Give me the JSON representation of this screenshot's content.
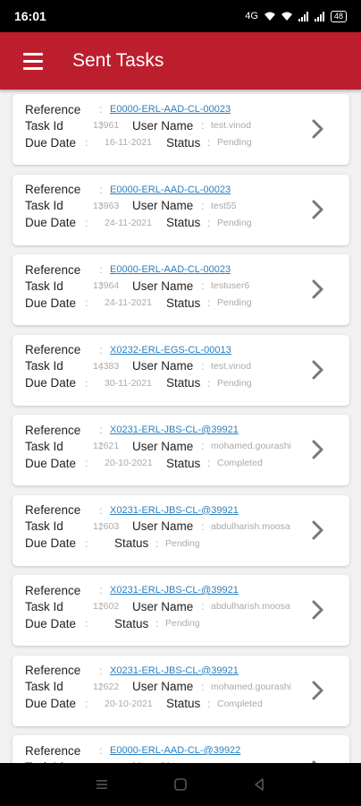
{
  "status_bar": {
    "time": "16:01",
    "battery": "48",
    "network": "4G"
  },
  "app_bar": {
    "title": "Sent Tasks"
  },
  "labels": {
    "reference": "Reference",
    "task_id": "Task Id",
    "user_name": "User Name",
    "due_date": "Due Date",
    "status": "Status",
    "colon": ":"
  },
  "tasks": [
    {
      "reference": "E0000-ERL-AAD-CL-00023",
      "task_id": "13961",
      "user_name": "test.vinod",
      "due_date": "16-11-2021",
      "status": "Pending"
    },
    {
      "reference": "E0000-ERL-AAD-CL-00023",
      "task_id": "13963",
      "user_name": "test55",
      "due_date": "24-11-2021",
      "status": "Pending"
    },
    {
      "reference": "E0000-ERL-AAD-CL-00023",
      "task_id": "13964",
      "user_name": "testuser6",
      "due_date": "24-11-2021",
      "status": "Pending"
    },
    {
      "reference": "X0232-ERL-EGS-CL-00013",
      "task_id": "14383",
      "user_name": "test.vinod",
      "due_date": "30-11-2021",
      "status": "Pending"
    },
    {
      "reference": "X0231-ERL-JBS-CL-@39921",
      "task_id": "12621",
      "user_name": "mohamed.gourashi",
      "due_date": "20-10-2021",
      "status": "Completed"
    },
    {
      "reference": "X0231-ERL-JBS-CL-@39921",
      "task_id": "12603",
      "user_name": "abdulharish.moosa",
      "due_date": "",
      "status": "Pending"
    },
    {
      "reference": "X0231-ERL-JBS-CL-@39921",
      "task_id": "12602",
      "user_name": "abdulharish.moosa",
      "due_date": "",
      "status": "Pending"
    },
    {
      "reference": "X0231-ERL-JBS-CL-@39921",
      "task_id": "12622",
      "user_name": "mohamed.gourashi",
      "due_date": "20-10-2021",
      "status": "Completed"
    },
    {
      "reference": "E0000-ERL-AAD-CL-@39922",
      "task_id": "",
      "user_name": "",
      "due_date": "",
      "status": ""
    }
  ],
  "icons": {
    "menu": "hamburger-icon",
    "chevron": "chevron-right-icon",
    "home": "home-icon",
    "back": "back-icon",
    "recents": "recents-icon"
  }
}
